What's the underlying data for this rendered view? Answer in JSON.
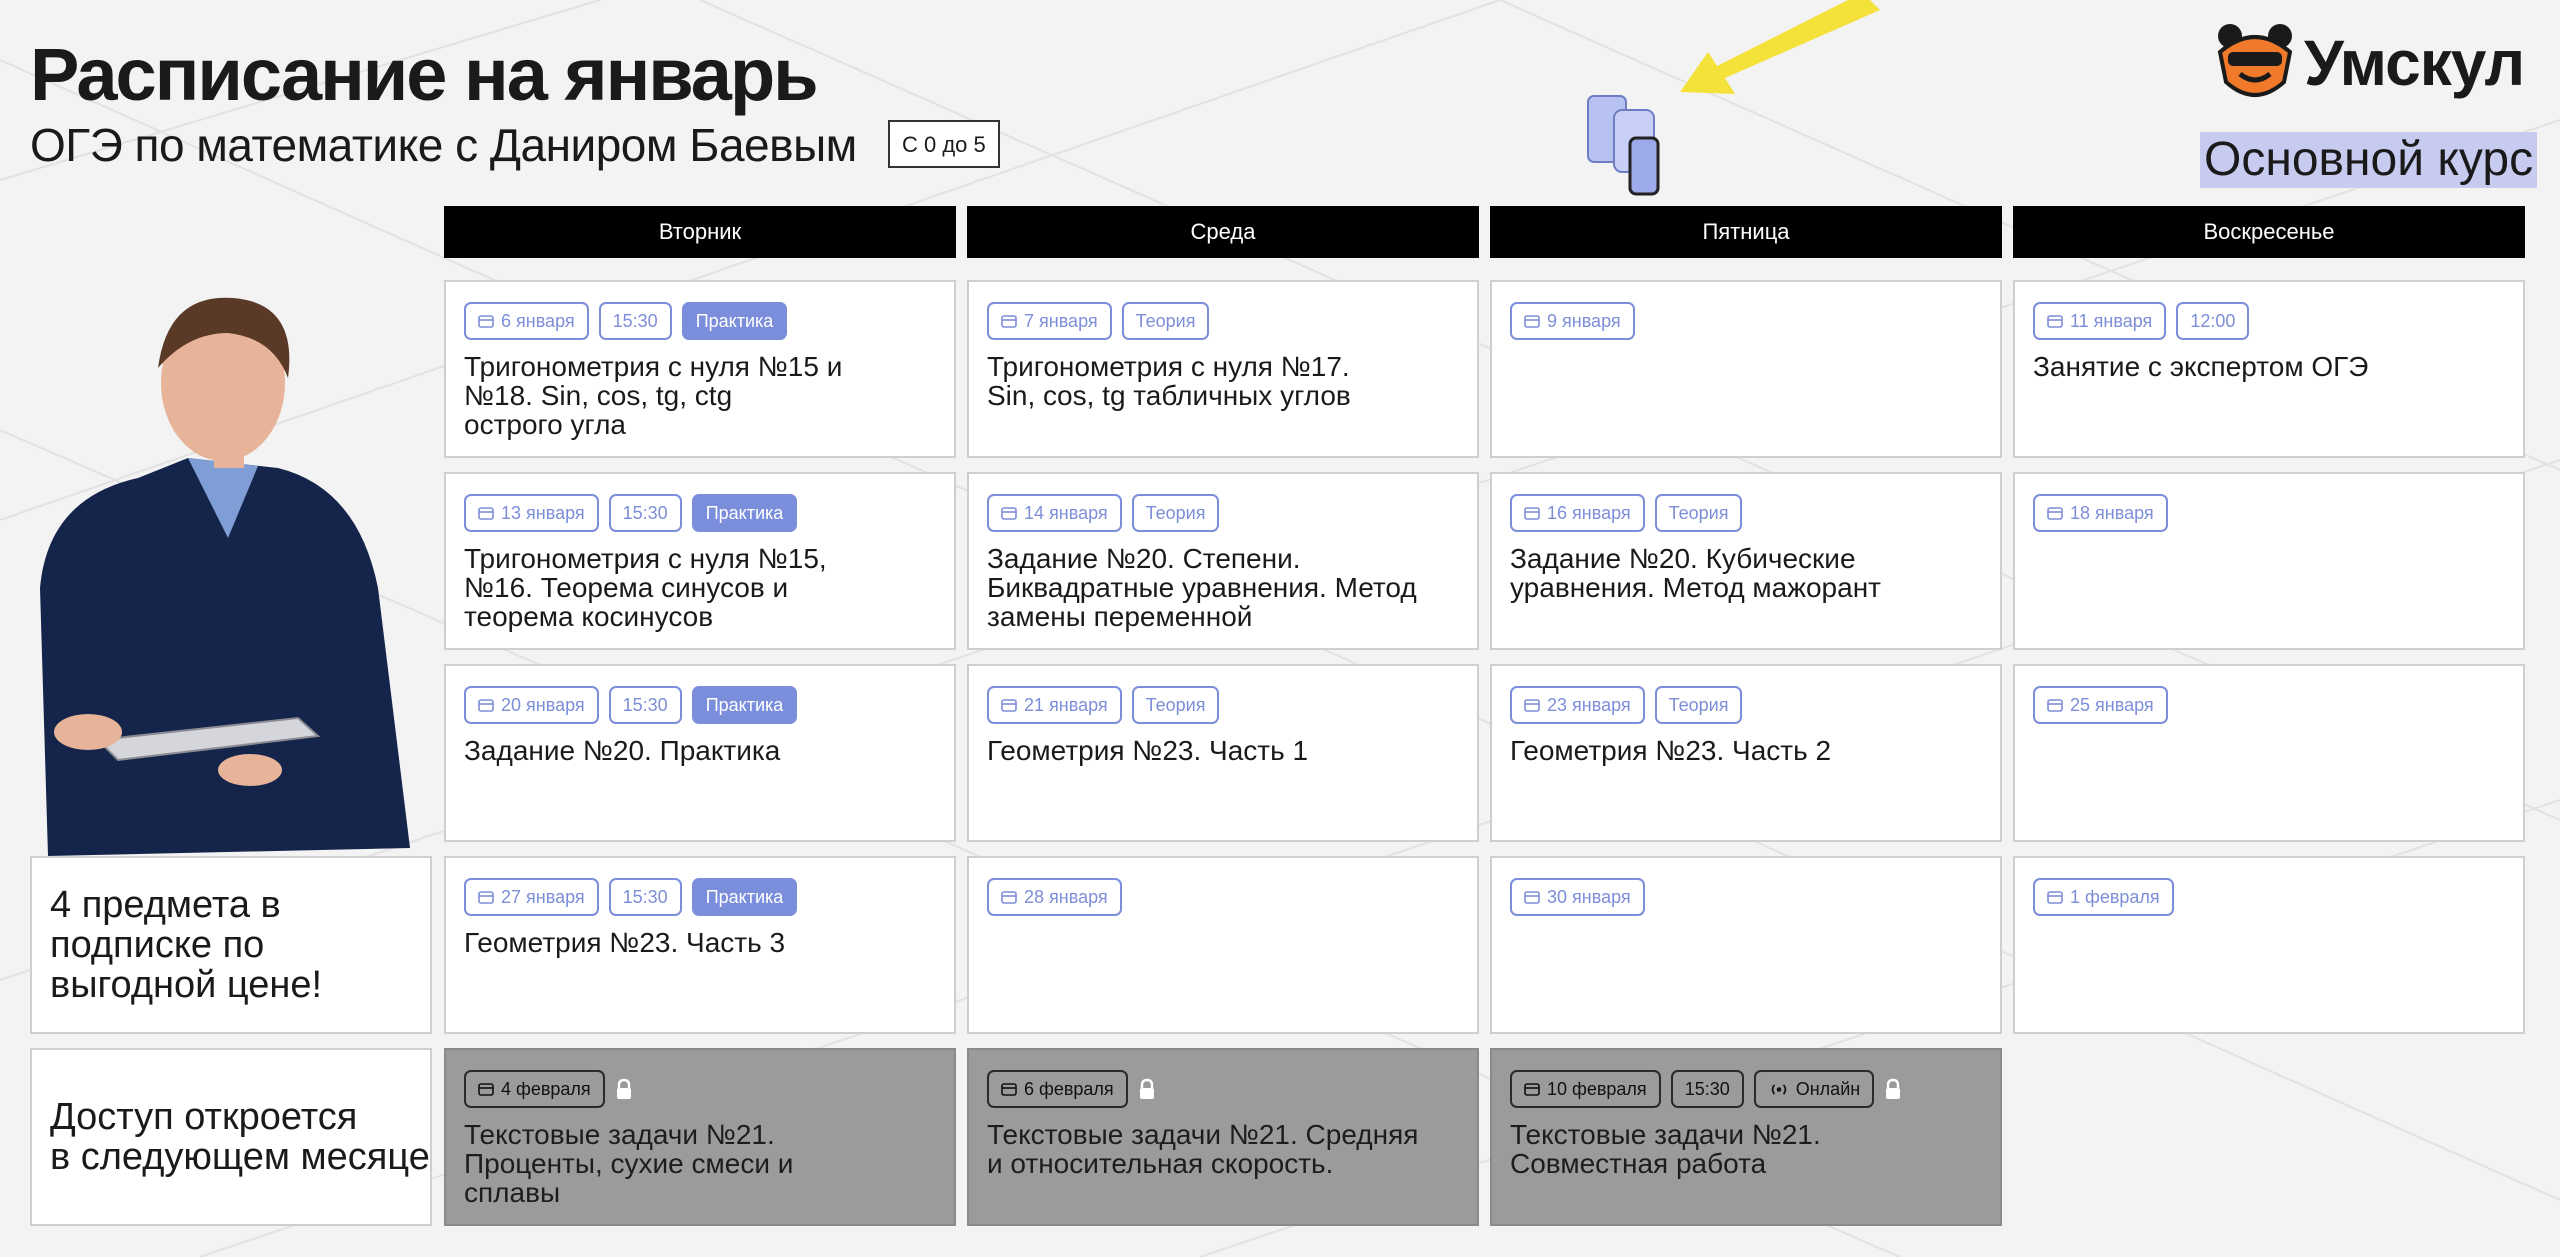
{
  "page": {
    "title": "Расписание на январь",
    "subtitle": "ОГЭ по математике с Даниром Баевым",
    "grade_badge": "С 0 до 5",
    "brand": "Умскул",
    "course_tag": "Основной курс"
  },
  "colors": {
    "accent": "#7b8edb",
    "header_bg": "#000000",
    "locked_bg": "#9b9b9b",
    "course_tag_bg": "#c6cbef",
    "logo_orange": "#f07a2a",
    "arrow_yellow": "#f4e23a"
  },
  "icons": {
    "date": "calendar-icon",
    "locked": "lock-icon",
    "online": "broadcast-icon"
  },
  "days": [
    "Вторник",
    "Среда",
    "Пятница",
    "Воскресенье"
  ],
  "rows": [
    [
      {
        "date": "6 января",
        "time": "15:30",
        "type": "Практика",
        "title": "Тригонометрия с нуля №15 и\n№18. Sin, cos, tg, ctg\nострого угла"
      },
      {
        "date": "7 января",
        "type": "Теория",
        "title": "Тригонометрия с нуля №17.\nSin, cos, tg табличных углов"
      },
      {
        "date": "9 января"
      },
      {
        "date": "11 января",
        "time": "12:00",
        "title": "Занятие с экспертом ОГЭ"
      }
    ],
    [
      {
        "date": "13 января",
        "time": "15:30",
        "type": "Практика",
        "title": "Тригонометрия с нуля №15,\n№16. Теорема синусов и\nтеорема косинусов"
      },
      {
        "date": "14 января",
        "type": "Теория",
        "title": "Задание №20. Степени.\nБиквадратные уравнения. Метод\nзамены переменной"
      },
      {
        "date": "16 января",
        "type": "Теория",
        "title": "Задание №20. Кубические\nуравнения. Метод мажорант"
      },
      {
        "date": "18 января"
      }
    ],
    [
      {
        "date": "20 января",
        "time": "15:30",
        "type": "Практика",
        "title": "Задание №20. Практика"
      },
      {
        "date": "21 января",
        "type": "Теория",
        "title": "Геометрия №23. Часть 1"
      },
      {
        "date": "23 января",
        "type": "Теория",
        "title": "Геометрия №23. Часть 2"
      },
      {
        "date": "25 января"
      }
    ],
    [
      {
        "date": "27 января",
        "time": "15:30",
        "type": "Практика",
        "title": "Геометрия №23. Часть 3"
      },
      {
        "date": "28 января"
      },
      {
        "date": "30 января"
      },
      {
        "date": "1 февраля"
      }
    ],
    [
      {
        "date": "4 февраля",
        "locked": true,
        "title": "Текстовые задачи №21.\nПроценты, сухие смеси и\nсплавы"
      },
      {
        "date": "6 февраля",
        "locked": true,
        "title": "Текстовые задачи №21. Средняя\nи относительная скорость."
      },
      {
        "date": "10 февраля",
        "time": "15:30",
        "mode": "Онлайн",
        "locked": true,
        "title": "Текстовые задачи №21.\nСовместная работа"
      }
    ]
  ],
  "side": {
    "promo": "4 предмета в\nподписке по\nвыгодной цене!",
    "next_month": "Доступ откроется\nв следующем месяце"
  }
}
